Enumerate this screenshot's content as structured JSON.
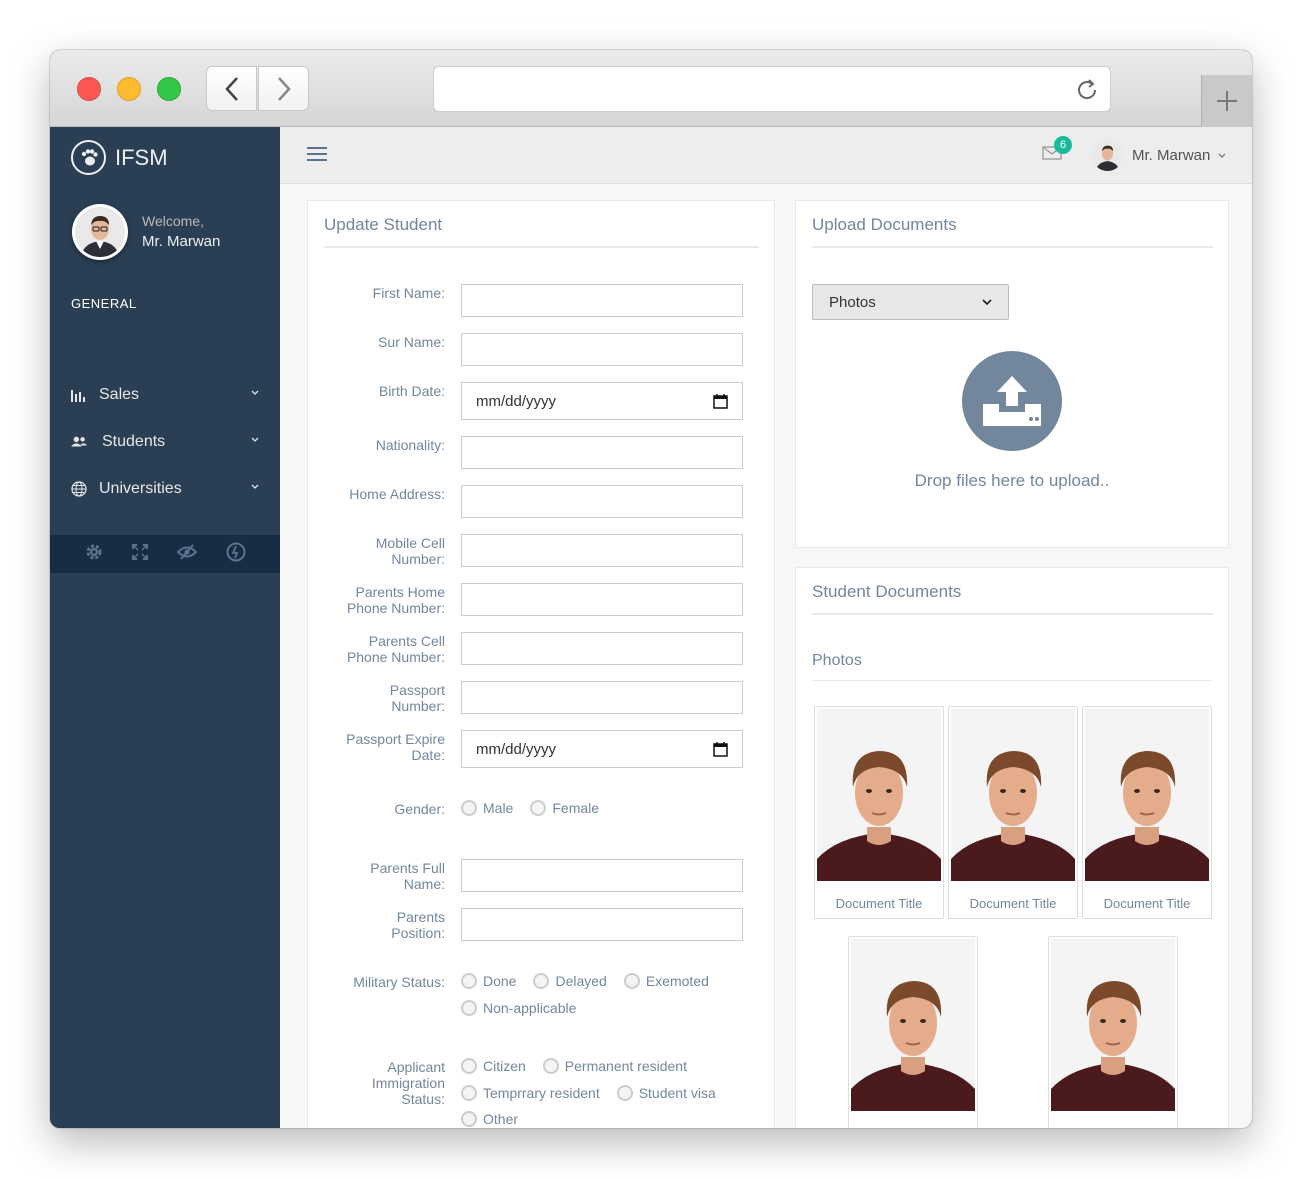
{
  "brand": {
    "name": "IFSM"
  },
  "profile": {
    "welcome": "Welcome,",
    "name": "Mr. Marwan"
  },
  "sidebar": {
    "section": "GENERAL",
    "items": [
      {
        "label": "Sales",
        "icon": "bar-chart-icon"
      },
      {
        "label": "Students",
        "icon": "users-icon"
      },
      {
        "label": "Universities",
        "icon": "globe-icon"
      }
    ],
    "footer_icons": [
      "gear-icon",
      "fullscreen-icon",
      "eye-slash-icon",
      "power-icon"
    ]
  },
  "topnav": {
    "mail_count": "6",
    "user_name": "Mr. Marwan"
  },
  "form": {
    "title": "Update Student",
    "fields": {
      "first_name": "First Name:",
      "sur_name": "Sur Name:",
      "birth_date": "Birth Date:",
      "nationality": "Nationality:",
      "home_address": "Home Address:",
      "mobile_cell_1": "Mobile Cell",
      "mobile_cell_2": "Number:",
      "parents_home_1": "Parents Home",
      "parents_home_2": "Phone Number:",
      "parents_cell_1": "Parents Cell",
      "parents_cell_2": "Phone Number:",
      "passport_1": "Passport",
      "passport_2": "Number:",
      "passport_exp_1": "Passport Expire",
      "passport_exp_2": "Date:",
      "gender": "Gender:",
      "parents_full_1": "Parents Full",
      "parents_full_2": "Name:",
      "parents_pos_1": "Parents",
      "parents_pos_2": "Position:",
      "military": "Military Status:",
      "immigration_1": "Applicant",
      "immigration_2": "Immigration",
      "immigration_3": "Status:"
    },
    "date_placeholder": "mm/dd/yyyy",
    "gender_options": [
      "Male",
      "Female"
    ],
    "military_options": [
      "Done",
      "Delayed",
      "Exemoted",
      "Non-applicable"
    ],
    "immigration_options": [
      "Citizen",
      "Permanent resident",
      "Temprrary resident",
      "Student visa",
      "Other"
    ]
  },
  "upload": {
    "title": "Upload Documents",
    "select_value": "Photos",
    "drop_text": "Drop files here to upload.."
  },
  "documents": {
    "title": "Student Documents",
    "category": "Photos",
    "caption": "Document Title"
  }
}
